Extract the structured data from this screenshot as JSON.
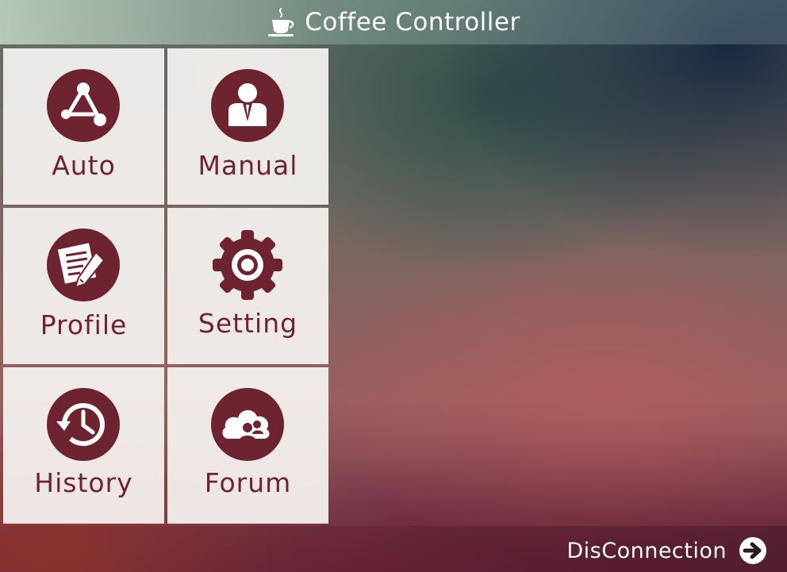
{
  "app": {
    "title": "Coffee Controller",
    "icon": "coffee-cup-icon"
  },
  "menu": {
    "tiles": [
      {
        "label": "Auto",
        "icon": "auto-network-icon"
      },
      {
        "label": "Manual",
        "icon": "manual-person-icon"
      },
      {
        "label": "Profile",
        "icon": "profile-edit-icon"
      },
      {
        "label": "Setting",
        "icon": "gear-icon"
      },
      {
        "label": "History",
        "icon": "history-clock-icon"
      },
      {
        "label": "Forum",
        "icon": "forum-cloud-icon"
      }
    ]
  },
  "footer": {
    "disconnect_label": "DisConnection",
    "icon": "arrow-right-circle-icon"
  },
  "colors": {
    "accent": "#6e2430",
    "tile_bg": "#f3f1ef",
    "text_light": "#ffffff"
  }
}
